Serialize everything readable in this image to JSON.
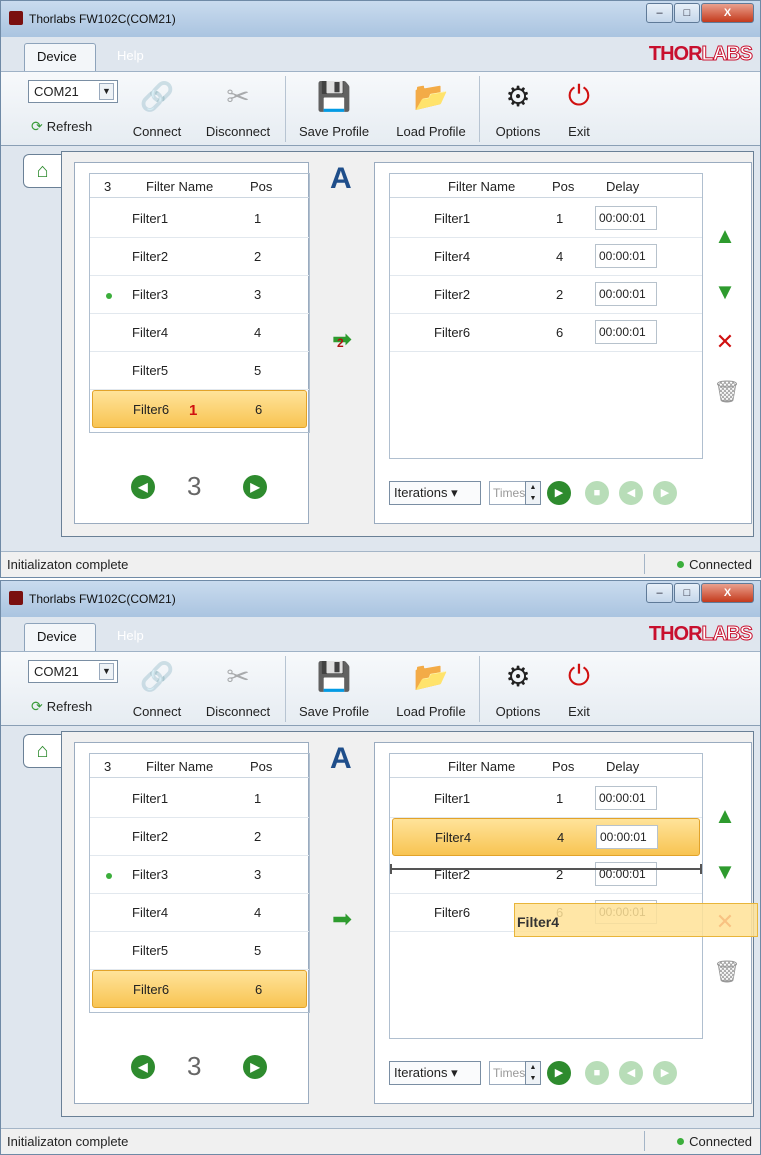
{
  "window": {
    "title": "Thorlabs FW102C(COM21)",
    "controls": {
      "minimize": "–",
      "maximize": "□",
      "close": "X"
    }
  },
  "menu": {
    "tabs": [
      "Device",
      "Help"
    ],
    "logo_a": "THOR",
    "logo_b": "LABS"
  },
  "ribbon": {
    "port": "COM21",
    "refresh": "Refresh",
    "buttons": [
      "Connect",
      "Disconnect",
      "Save Profile",
      "Load Profile",
      "Options",
      "Exit"
    ]
  },
  "filters": {
    "header": {
      "index": "3",
      "name": "Filter Name",
      "pos": "Pos"
    },
    "rows": [
      {
        "name": "Filter1",
        "pos": "1"
      },
      {
        "name": "Filter2",
        "pos": "2"
      },
      {
        "name": "Filter3",
        "pos": "3"
      },
      {
        "name": "Filter4",
        "pos": "4"
      },
      {
        "name": "Filter5",
        "pos": "5"
      },
      {
        "name": "Filter6",
        "pos": "6"
      }
    ],
    "count": "3"
  },
  "sequence": {
    "header": {
      "name": "Filter Name",
      "pos": "Pos",
      "delay": "Delay"
    },
    "rows": [
      {
        "name": "Filter1",
        "pos": "1",
        "delay": "00:00:01"
      },
      {
        "name": "Filter4",
        "pos": "4",
        "delay": "00:00:01"
      },
      {
        "name": "Filter2",
        "pos": "2",
        "delay": "00:00:01"
      },
      {
        "name": "Filter6",
        "pos": "6",
        "delay": "00:00:01"
      }
    ],
    "iterations": "Iterations",
    "times": "Times"
  },
  "markers": {
    "one": "1",
    "two": "2",
    "letter": "A"
  },
  "drag": {
    "ghost": "Filter4"
  },
  "status": {
    "message": "Initializaton complete",
    "connection": "Connected"
  },
  "colors": {
    "accent": "#2e8b2e",
    "selection": "#f8c452",
    "brand": "#c8102e"
  }
}
